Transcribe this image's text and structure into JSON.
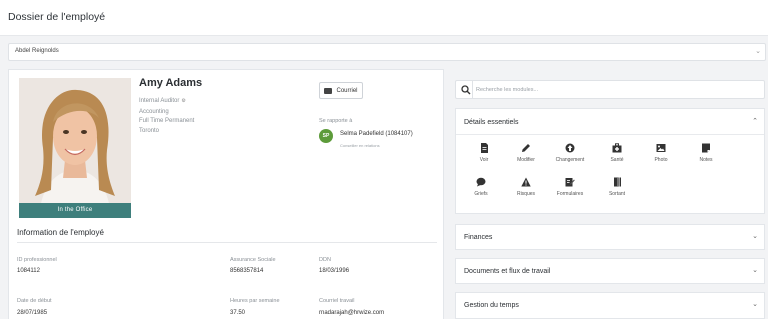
{
  "page": {
    "title": "Dossier de l'employé"
  },
  "selector": {
    "value": "Abdel Reignolds",
    "chevron_icon": "chevron-down-icon"
  },
  "employee": {
    "name": "Amy Adams",
    "role": "Internal Auditor",
    "department": "Accounting",
    "employment_type": "Full Time Permanent",
    "location": "Toronto",
    "status_tag": "In the Office",
    "mail_button": "Courriel",
    "reports_to_label": "Se rapporte à",
    "manager": {
      "initials": "SP",
      "name": "Selma Padefield (1084107)",
      "sub": "Conseiller en relations"
    }
  },
  "info": {
    "title": "Information de l'employé",
    "fields": [
      {
        "label": "ID professionnel",
        "value": "1084112"
      },
      {
        "label": "Assurance Sociale",
        "value": "8568357814"
      },
      {
        "label": "DDN",
        "value": "18/03/1996"
      },
      {
        "label": "Date de début",
        "value": "28/07/1985"
      },
      {
        "label": "Heures par semaine",
        "value": "37.50"
      },
      {
        "label": "Courriel travail",
        "value": "rnadarajah@hrwize.com"
      }
    ]
  },
  "search": {
    "placeholder": "Recherche les modules..."
  },
  "essentials": {
    "title": "Détails essentiels",
    "modules": [
      {
        "label": "Voir",
        "icon": "document-icon"
      },
      {
        "label": "Modifier",
        "icon": "pencil-icon"
      },
      {
        "label": "Changement",
        "icon": "upload-icon"
      },
      {
        "label": "Santé",
        "icon": "medical-kit-icon"
      },
      {
        "label": "Photo",
        "icon": "image-icon"
      },
      {
        "label": "Notes",
        "icon": "notes-icon"
      },
      {
        "label": "Griefs",
        "icon": "chat-bubble-icon"
      },
      {
        "label": "Risques",
        "icon": "warning-icon"
      },
      {
        "label": "Formulaires",
        "icon": "form-icon"
      },
      {
        "label": "Sortant",
        "icon": "exit-door-icon"
      }
    ]
  },
  "sections": [
    {
      "title": "Finances"
    },
    {
      "title": "Documents et flux de travail"
    },
    {
      "title": "Gestion du temps"
    }
  ],
  "colors": {
    "status_tag": "#3e7f7c",
    "manager_avatar": "#5d9b3a",
    "background": "#f2f3f5"
  }
}
